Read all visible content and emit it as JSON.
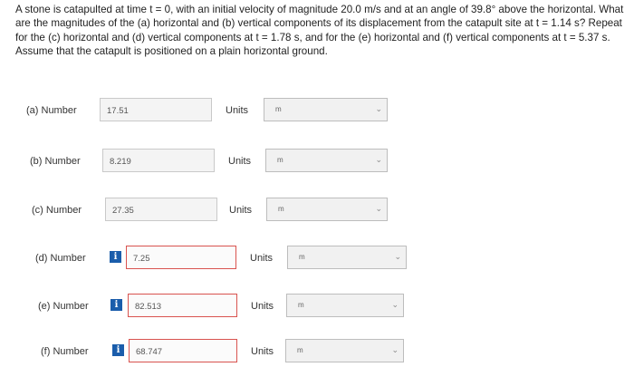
{
  "question": "A stone is catapulted at time t = 0, with an initial velocity of magnitude 20.0 m/s and at an angle of 39.8° above the horizontal. What are the magnitudes of the (a) horizontal and (b) vertical components of its displacement from the catapult site at t = 1.14 s? Repeat for the (c) horizontal and (d) vertical components at t = 1.78 s, and for the (e) horizontal and (f) vertical components at t = 5.37 s. Assume that the catapult is positioned on a plain horizontal ground.",
  "units_label": "Units",
  "info_glyph": "i",
  "chevron_glyph": "⌄",
  "rows": [
    {
      "label": "(a) Number",
      "value": "17.51",
      "unit": "m"
    },
    {
      "label": "(b) Number",
      "value": "8.219",
      "unit": "m"
    },
    {
      "label": "(c) Number",
      "value": "27.35",
      "unit": "m"
    },
    {
      "label": "(d) Number",
      "value": "7.25",
      "unit": "m"
    },
    {
      "label": "(e) Number",
      "value": "82.513",
      "unit": "m"
    },
    {
      "label": "(f) Number",
      "value": "68.747",
      "unit": "m"
    }
  ]
}
